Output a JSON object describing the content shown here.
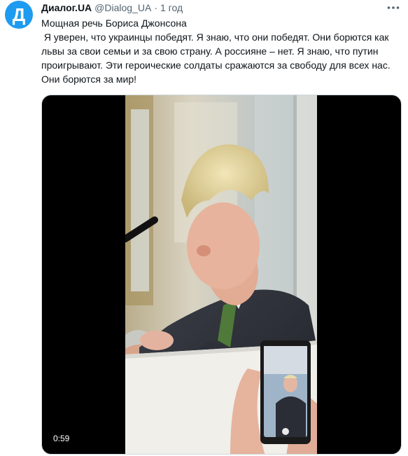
{
  "account": {
    "avatar_letter": "Д",
    "display_name": "Диалог.UA",
    "handle": "@Dialog_UA",
    "separator": "·",
    "time": "1 год"
  },
  "tweet": {
    "title": "Мощная речь Бориса Джонсона",
    "body": " Я уверен, что украинцы победят. Я знаю, что они победят. Они борются как львы за свои семьи и за свою страну. А россияне – нет. Я знаю, что путин проигрывают. Эти героические солдаты сражаются за свободу для всех нас. Они борются за мир!"
  },
  "media": {
    "type": "video",
    "duration": "0:59"
  },
  "colors": {
    "brand_blue": "#1d9bf0",
    "text_primary": "#0f1419",
    "text_secondary": "#536471"
  },
  "icons": {
    "more": "more-horizontal-icon"
  }
}
